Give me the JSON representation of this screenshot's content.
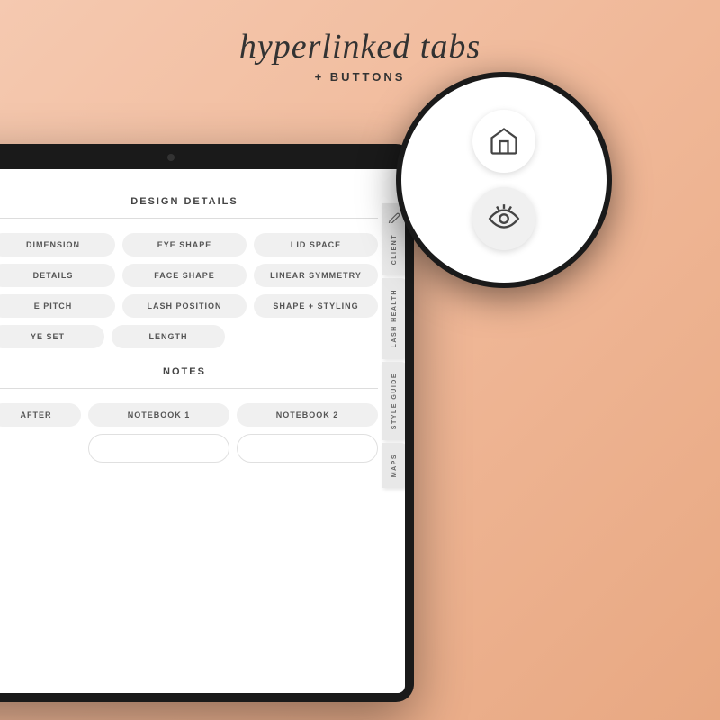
{
  "header": {
    "title": "hyperlinked tabs",
    "subtitle": "+ BUTTONS"
  },
  "tablet": {
    "sections": {
      "design_details": {
        "label": "DESIGN DETAILS",
        "row1": [
          "DIMENSION",
          "EYE SHAPE",
          "LID SPACE"
        ],
        "row2": [
          "DETAILS",
          "FACE SHAPE",
          "LINEAR SYMMETRY"
        ],
        "row3": [
          "E PITCH",
          "LASH POSITION",
          "SHAPE + STYLING"
        ],
        "row4": [
          "YE SET",
          "LENGTH"
        ]
      },
      "notes": {
        "label": "NOTES",
        "row1_left": "AFTER",
        "notebook1": "NOTEBOOK 1",
        "notebook2": "NOTEBOOK 2"
      }
    },
    "side_tabs": [
      "CLIENT",
      "LASH HEALTH",
      "STYLE GUIDE",
      "MAPS"
    ],
    "pencil_icon": "✏"
  },
  "magnifier": {
    "home_icon_label": "home-icon",
    "eye_icon_label": "eye-icon"
  },
  "colors": {
    "background": "#f2c4a8",
    "tablet_body": "#1a1a1a",
    "screen_bg": "#ffffff",
    "pill_bg": "#f0f0f0",
    "text_dark": "#333333",
    "text_medium": "#555555",
    "accent_peach": "#f0b898"
  }
}
